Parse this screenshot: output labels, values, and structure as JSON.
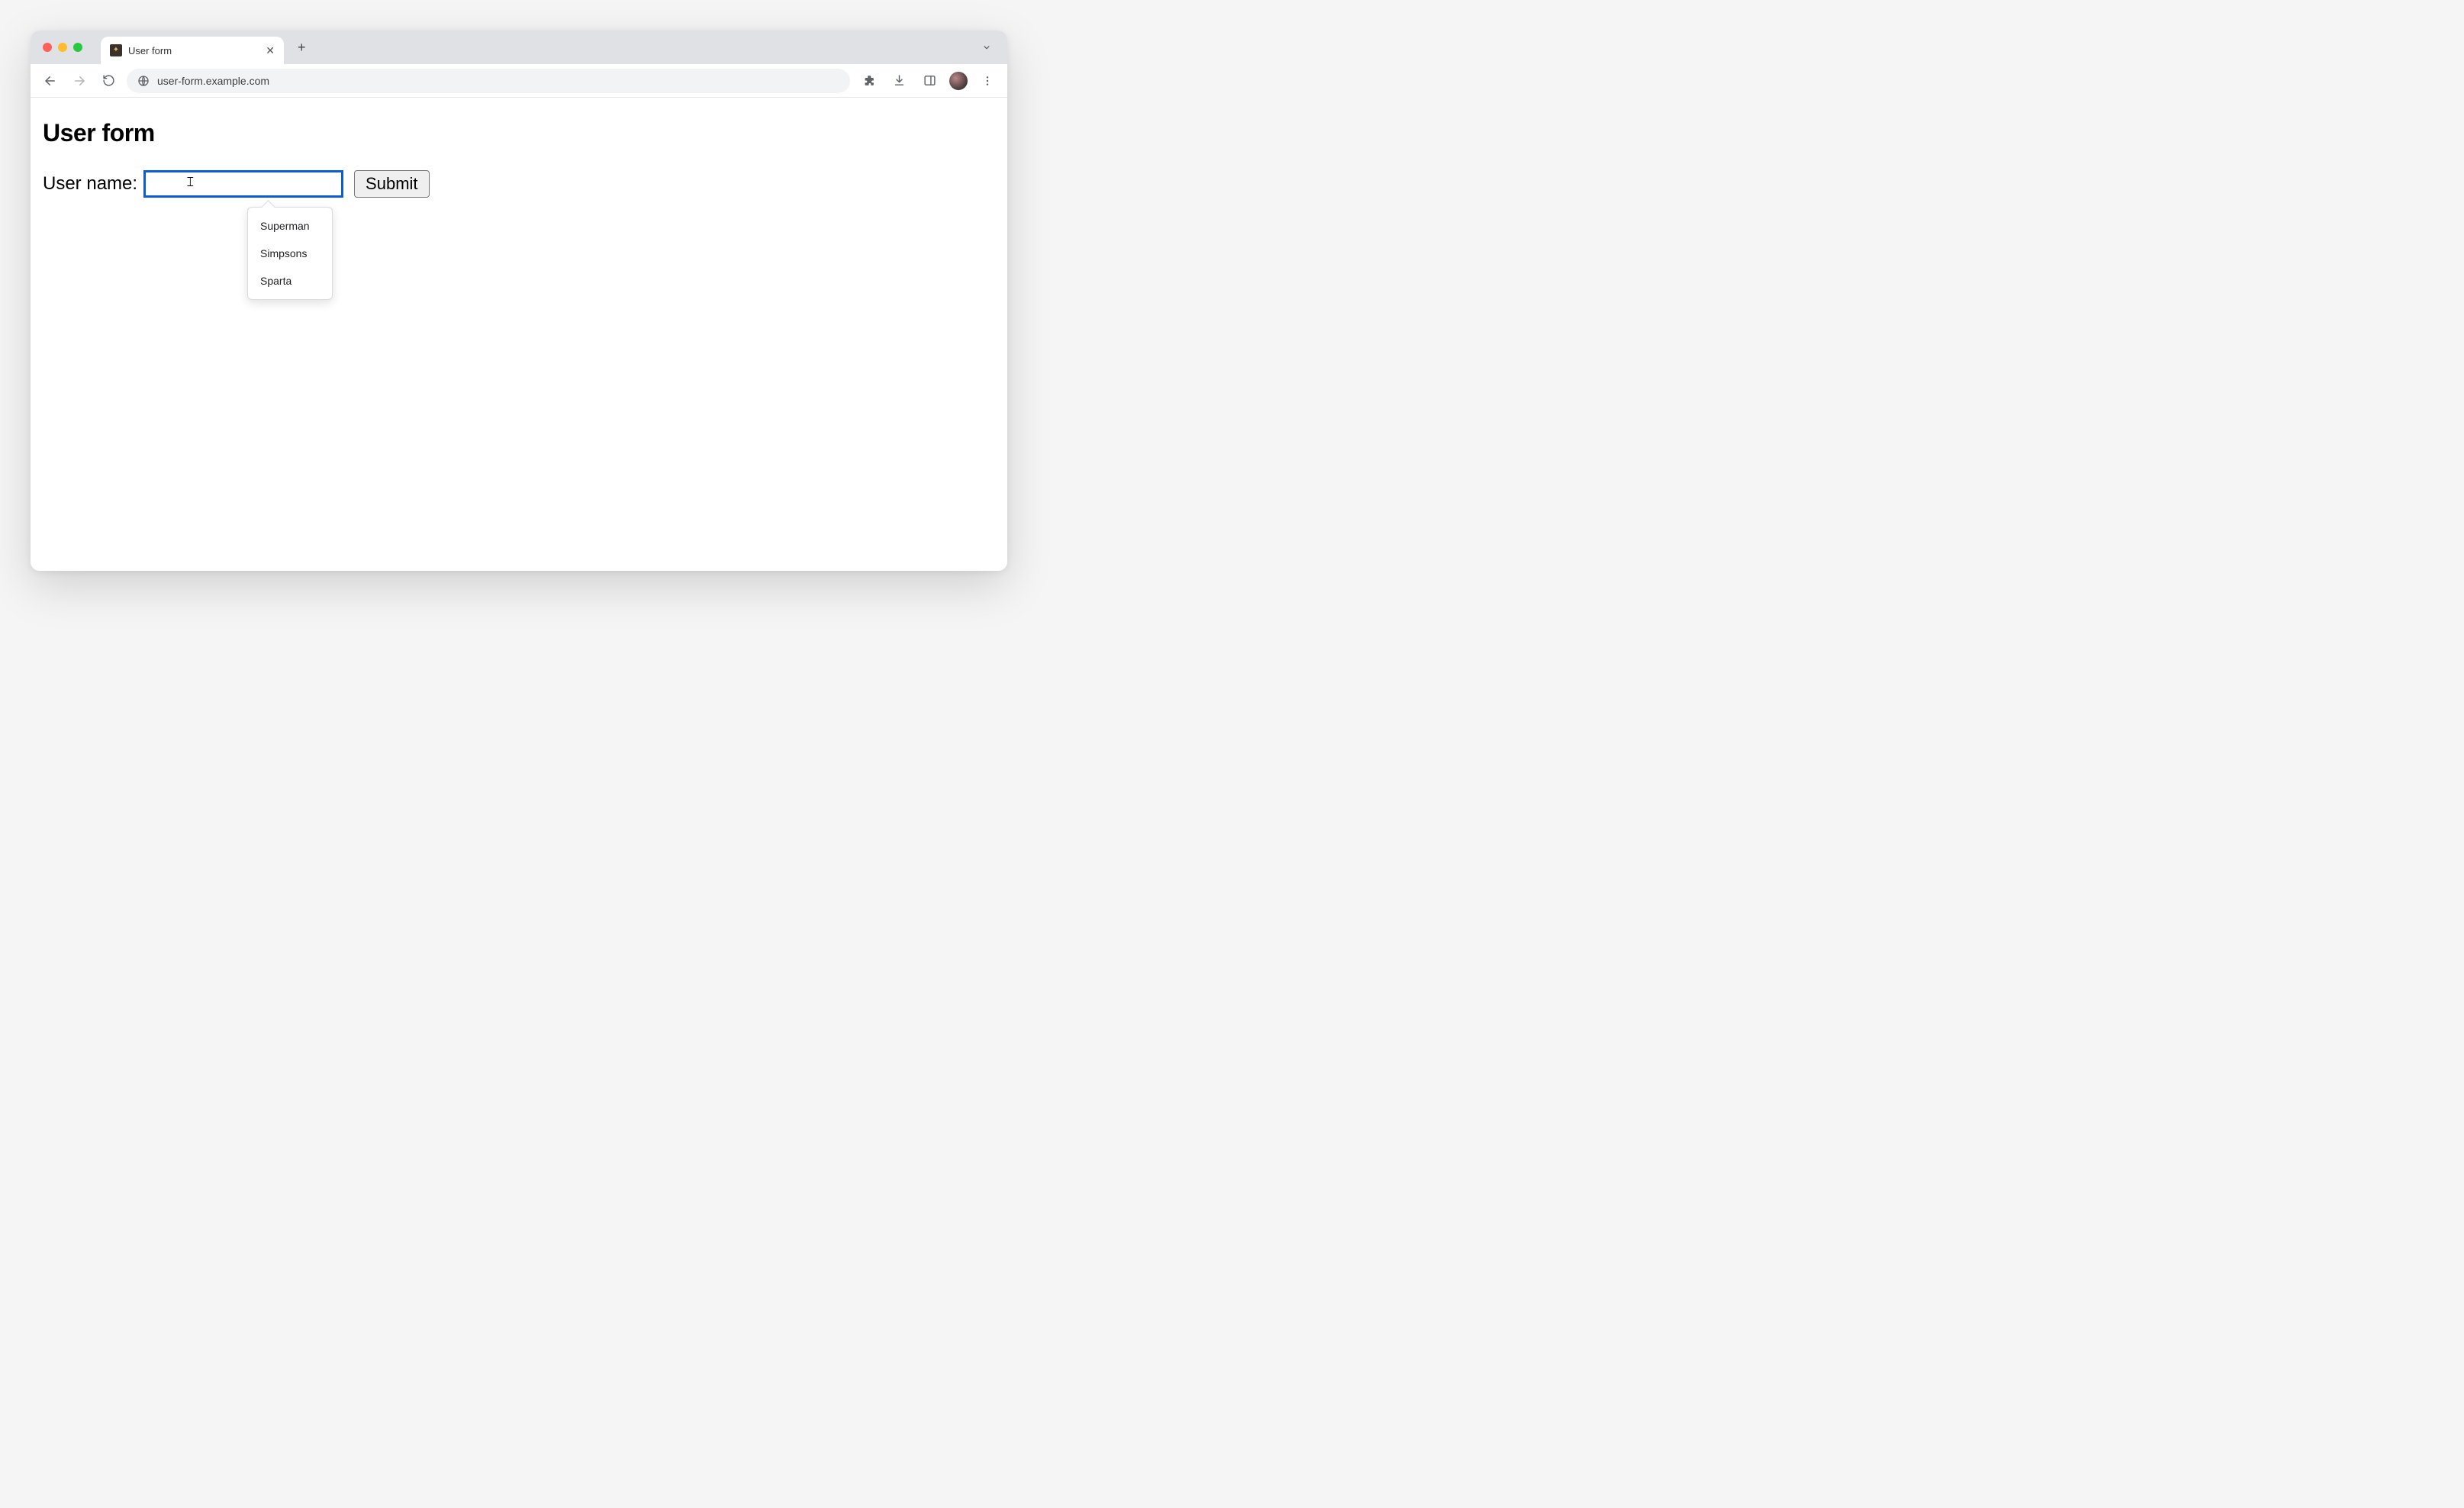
{
  "browser": {
    "tab_title": "User form",
    "url": "user-form.example.com"
  },
  "page": {
    "heading": "User form",
    "form": {
      "username_label": "User name:",
      "username_value": "",
      "submit_label": "Submit",
      "autocomplete_options": [
        "Superman",
        "Simpsons",
        "Sparta"
      ]
    }
  }
}
